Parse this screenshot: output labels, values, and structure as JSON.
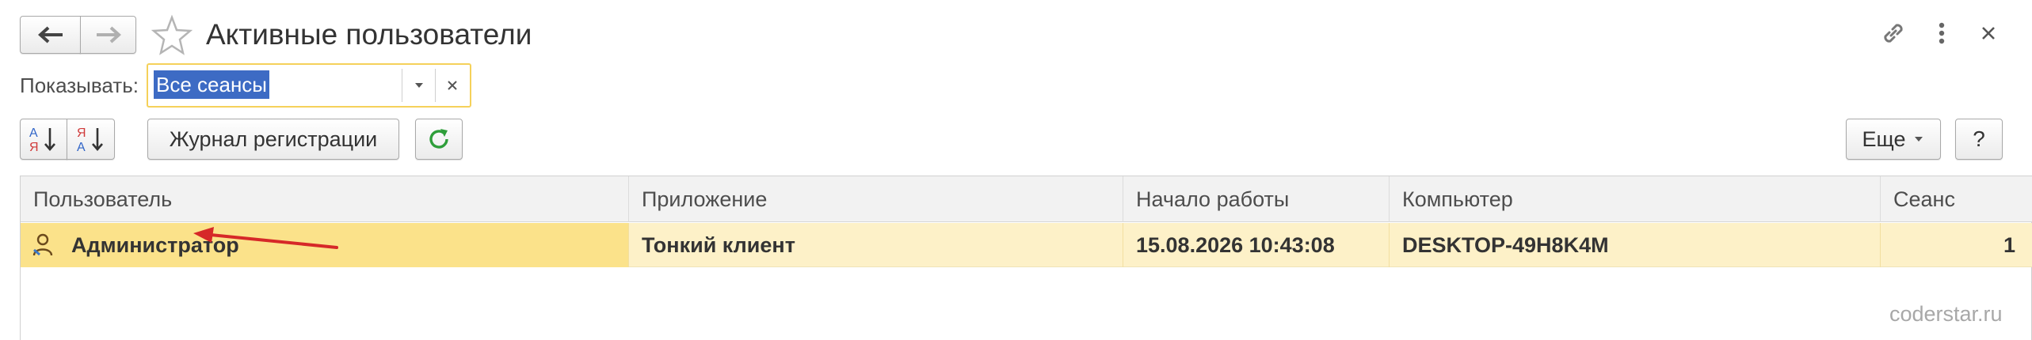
{
  "window": {
    "title": "Активные пользователи"
  },
  "filter": {
    "label": "Показывать:",
    "value": "Все сеансы"
  },
  "toolbar": {
    "sort_asc_icon_text": "А Я",
    "sort_desc_icon_text": "Я А",
    "journal_label": "Журнал регистрации",
    "more_label": "Еще",
    "help_label": "?"
  },
  "table": {
    "columns": [
      "Пользователь",
      "Приложение",
      "Начало работы",
      "Компьютер",
      "Сеанс"
    ],
    "rows": [
      {
        "user": "Администратор",
        "application": "Тонкий клиент",
        "start": "15.08.2026 10:43:08",
        "computer": "DESKTOP-49H8K4M",
        "session": "1"
      }
    ]
  },
  "watermark": "coderstar.ru",
  "colors": {
    "filter_border": "#f5d15a",
    "selection": "#3d6bc4",
    "row_highlight": "#fdf1c8",
    "row_selected_cell": "#fbe28a",
    "refresh_green": "#2e9e3a",
    "arrow_red": "#d62828"
  }
}
